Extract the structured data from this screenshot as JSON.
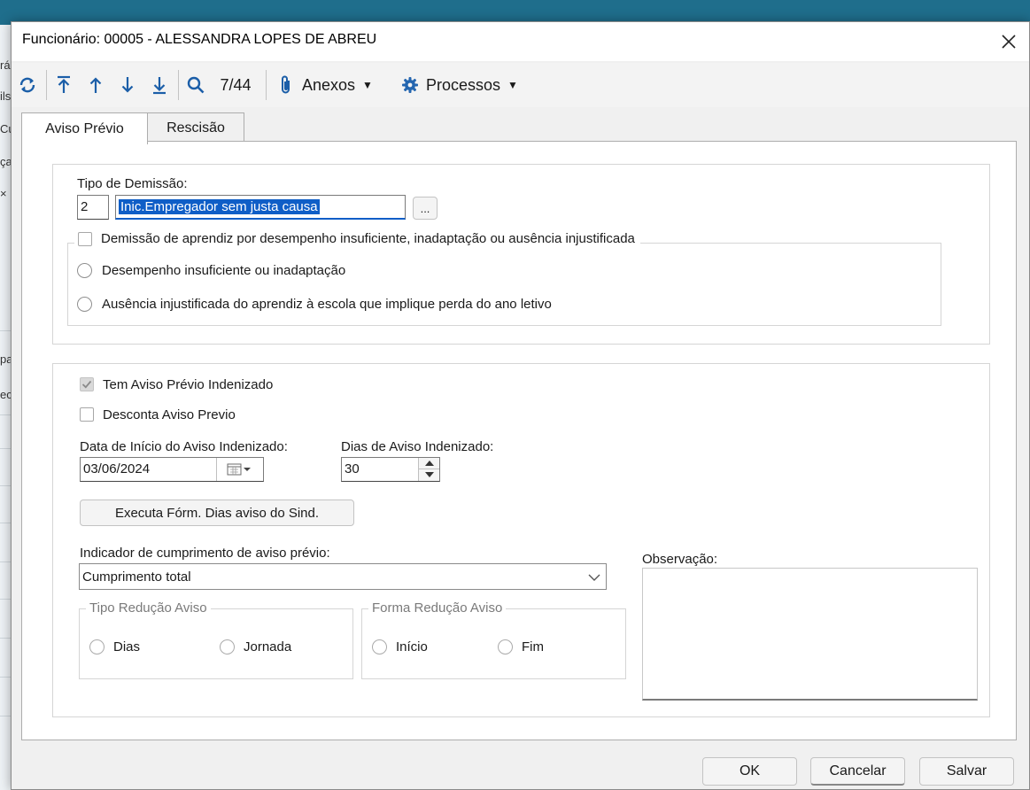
{
  "background": {
    "left_snippets": [
      "rá",
      "ils",
      "Cu",
      "ça",
      "×",
      "pa",
      "ec"
    ]
  },
  "dialog": {
    "title": "Funcionário: 00005 - ALESSANDRA LOPES DE ABREU"
  },
  "toolbar": {
    "record_position": "7/44",
    "attachments_label": "Anexos",
    "processes_label": "Processos"
  },
  "tabs": [
    {
      "label": "Aviso Prévio",
      "active": true
    },
    {
      "label": "Rescisão",
      "active": false
    }
  ],
  "dismissal": {
    "label": "Tipo de Demissão:",
    "code": "2",
    "description": "Inic.Empregador sem justa causa",
    "lookup_label": "...",
    "apprentice_checkbox_label": "Demissão de aprendiz por desempenho insuficiente, inadaptação ou ausência injustificada",
    "apprentice_checked": false,
    "radio_performance_label": "Desempenho insuficiente ou inadaptação",
    "radio_absence_label": "Ausência injustificada do aprendiz à escola que implique perda do ano letivo"
  },
  "notice": {
    "indemnified_label": "Tem Aviso Prévio Indenizado",
    "indemnified_checked": true,
    "discount_label": "Desconta Aviso Previo",
    "discount_checked": false,
    "start_date_label": "Data de Início do Aviso Indenizado:",
    "start_date_value": "03/06/2024",
    "days_label": "Dias de Aviso Indenizado:",
    "days_value": "30",
    "run_formula_label": "Executa Fórm. Dias aviso do Sind.",
    "indicator_label": "Indicador de cumprimento de aviso prévio:",
    "indicator_value": "Cumprimento total",
    "reduction_type_legend": "Tipo Redução Aviso",
    "reduction_days_label": "Dias",
    "reduction_workday_label": "Jornada",
    "reduction_form_legend": "Forma Redução Aviso",
    "form_start_label": "Início",
    "form_end_label": "Fim",
    "observation_label": "Observação:",
    "observation_value": ""
  },
  "footer": {
    "ok_label": "OK",
    "cancel_label": "Cancelar",
    "save_label": "Salvar"
  },
  "colors": {
    "accent": "#1b5ea8",
    "selection": "#0f5ec7",
    "gear": "#2466b0"
  }
}
